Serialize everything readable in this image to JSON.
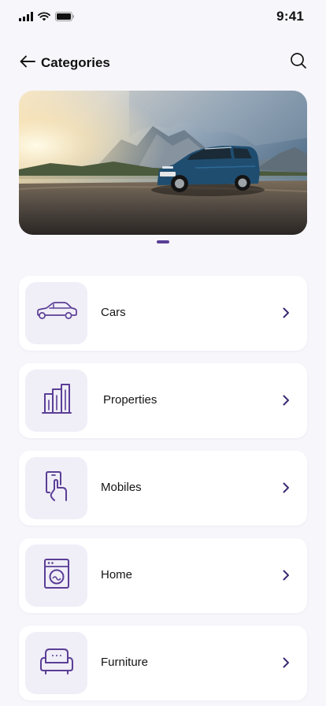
{
  "status_bar": {
    "time": "9:41"
  },
  "header": {
    "title": "Categories"
  },
  "banner": {
    "active_slide": 1
  },
  "categories": [
    {
      "label": "Cars",
      "icon": "car-icon"
    },
    {
      "label": "Properties",
      "icon": "building-icon"
    },
    {
      "label": "Mobiles",
      "icon": "mobile-phone-icon"
    },
    {
      "label": "Home",
      "icon": "washing-machine-icon"
    },
    {
      "label": "Furniture",
      "icon": "sofa-icon"
    }
  ],
  "colors": {
    "accent": "#5a3e96",
    "icon_bg": "#f0eef7",
    "background": "#f7f6fb"
  }
}
